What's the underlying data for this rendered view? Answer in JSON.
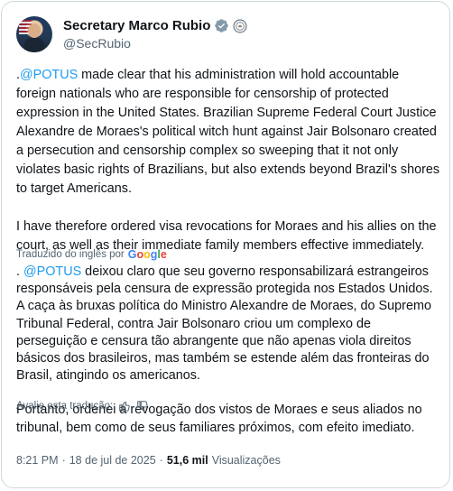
{
  "author": {
    "display_name": "Secretary Marco Rubio",
    "handle": "@SecRubio",
    "verified_icon": "verified-badge-icon",
    "affiliation_icon": "government-seal-icon"
  },
  "tweet": {
    "para1_mention": "@POTUS",
    "para1_prefix": ".",
    "para1_text": " made clear that his administration will hold accountable foreign nationals who are responsible for censorship of protected expression in the United States. Brazilian Supreme Federal Court Justice Alexandre de Moraes's political witch hunt against Jair Bolsonaro created a persecution and censorship complex so sweeping that it not only violates basic rights of Brazilians, but also extends beyond Brazil's shores to target Americans.",
    "para2_text": "I have therefore ordered visa revocations for Moraes and his allies on the court, as well as their immediate family members effective immediately."
  },
  "translation": {
    "label": "Traduzido do inglês por",
    "provider": "Google",
    "para1_prefix": ". ",
    "para1_mention": "@POTUS",
    "para1_text": " deixou claro que seu governo responsabilizará estrangeiros responsáveis pela censura de expressão protegida nos Estados Unidos. A caça às bruxas política do Ministro Alexandre de Moraes, do Supremo Tribunal Federal, contra Jair Bolsonaro criou um complexo de perseguição e censura tão abrangente que não apenas viola direitos básicos dos brasileiros, mas também se estende além das fronteiras do Brasil, atingindo os americanos.",
    "para2_text": "Portanto, ordenei a revogação dos vistos de Moraes e seus aliados no tribunal, bem como de seus familiares próximos, com efeito imediato.",
    "rate_label": "Avalie esta tradução:"
  },
  "meta": {
    "time": "8:21 PM",
    "separator1": "·",
    "date": "18 de jul de 2025",
    "separator2": "·",
    "views_count": "51,6 mil",
    "views_label": "Visualizações"
  },
  "colors": {
    "link": "#1d9bf0",
    "secondary_text": "#536471",
    "primary_text": "#0f1419",
    "border": "#cfd9de"
  }
}
